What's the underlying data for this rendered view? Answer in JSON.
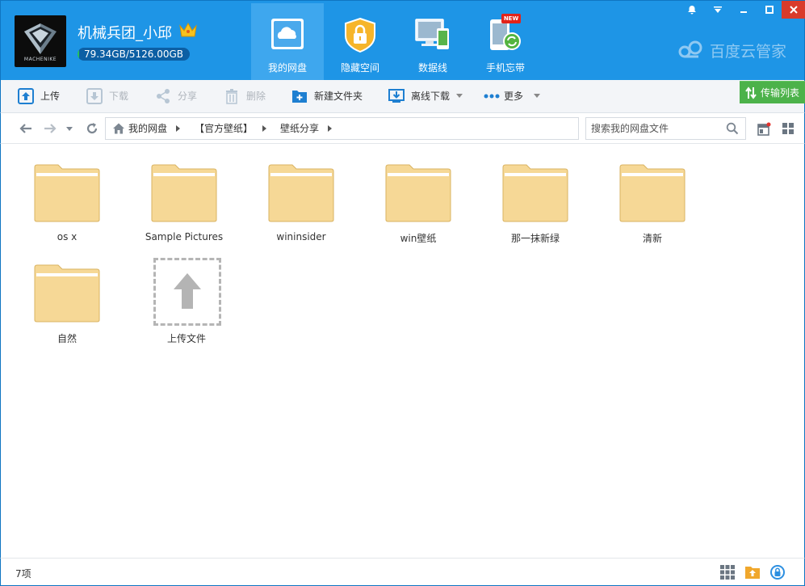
{
  "header": {
    "logo_text": "MACHENIKE",
    "username": "机械兵团_小邱",
    "quota_text": "79.34GB/5126.00GB",
    "quota_fraction": 0.0155,
    "brand": "百度云管家",
    "nav": [
      {
        "label": "我的网盘",
        "icon": "cloud-icon",
        "active": true
      },
      {
        "label": "隐藏空间",
        "icon": "lock-icon",
        "active": false
      },
      {
        "label": "数据线",
        "icon": "devices-icon",
        "active": false
      },
      {
        "label": "手机忘带",
        "icon": "phone-sync-icon",
        "active": false
      }
    ],
    "new_badge": "NEW"
  },
  "toolbar": {
    "upload": "上传",
    "download": "下载",
    "share": "分享",
    "delete": "删除",
    "new_folder": "新建文件夹",
    "offline_download": "离线下载",
    "more": "更多",
    "transfer_list": "传输列表"
  },
  "address": {
    "crumbs": [
      "我的网盘",
      "【官方壁纸】",
      "壁纸分享"
    ],
    "search_placeholder": "搜索我的网盘文件"
  },
  "files": [
    {
      "name": "os x",
      "type": "folder"
    },
    {
      "name": "Sample Pictures",
      "type": "folder"
    },
    {
      "name": "wininsider",
      "type": "folder"
    },
    {
      "name": "win壁纸",
      "type": "folder"
    },
    {
      "name": "那一抹新绿",
      "type": "folder"
    },
    {
      "name": "清新",
      "type": "folder"
    },
    {
      "name": "自然",
      "type": "folder"
    }
  ],
  "upload_tile": {
    "label": "上传文件"
  },
  "status": {
    "count": "7项"
  },
  "colors": {
    "header": "#1e95e6",
    "active_tab": "#3ea7ee",
    "folder": "#f6d896",
    "transfer": "#4cb24a"
  }
}
